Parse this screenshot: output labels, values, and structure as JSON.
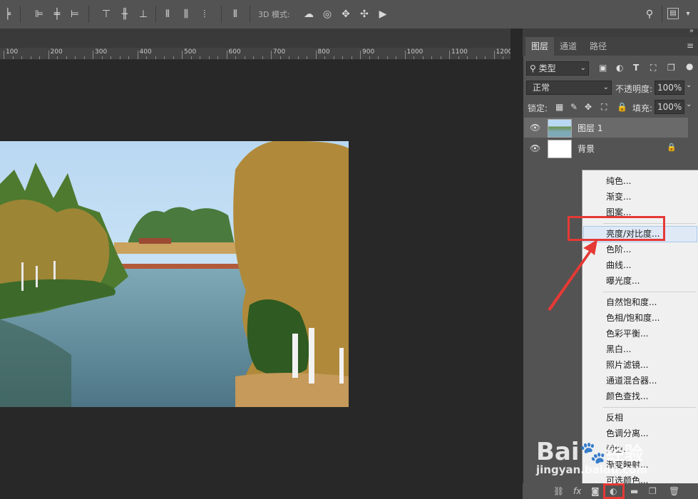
{
  "options_bar": {
    "mode_3d_label": "3D 模式:"
  },
  "ruler": {
    "ticks": [
      "100",
      "200",
      "300",
      "400",
      "500",
      "600",
      "700",
      "800",
      "900",
      "1000",
      "1100",
      "1200"
    ]
  },
  "panel": {
    "tabs": [
      "图层",
      "通道",
      "路径"
    ],
    "filter_kind": "类型",
    "blend_mode": "正常",
    "opacity_label": "不透明度:",
    "opacity_value": "100%",
    "lock_label": "锁定:",
    "fill_label": "填充:",
    "fill_value": "100%",
    "layers": [
      {
        "name": "图层 1",
        "selected": true
      },
      {
        "name": "背景",
        "selected": false,
        "locked": true
      }
    ]
  },
  "adjustment_menu": {
    "groups": [
      [
        "纯色...",
        "渐变...",
        "图案..."
      ],
      [
        "亮度/对比度...",
        "色阶...",
        "曲线...",
        "曝光度..."
      ],
      [
        "自然饱和度...",
        "色相/饱和度...",
        "色彩平衡...",
        "黑白...",
        "照片滤镜...",
        "通道混合器...",
        "颜色查找..."
      ],
      [
        "反相",
        "色调分离...",
        "阈值...",
        "渐变映射...",
        "可选颜色..."
      ]
    ],
    "highlighted": "亮度/对比度..."
  },
  "bottom_bar": {
    "fx_label": "fx"
  },
  "watermark": {
    "brand": "Bai",
    "brand_suffix": "经验",
    "url": "jingyan.baidu.com"
  },
  "colors": {
    "annotation_red": "#e53935",
    "panel_bg": "#535353",
    "canvas_bg": "#282828"
  }
}
